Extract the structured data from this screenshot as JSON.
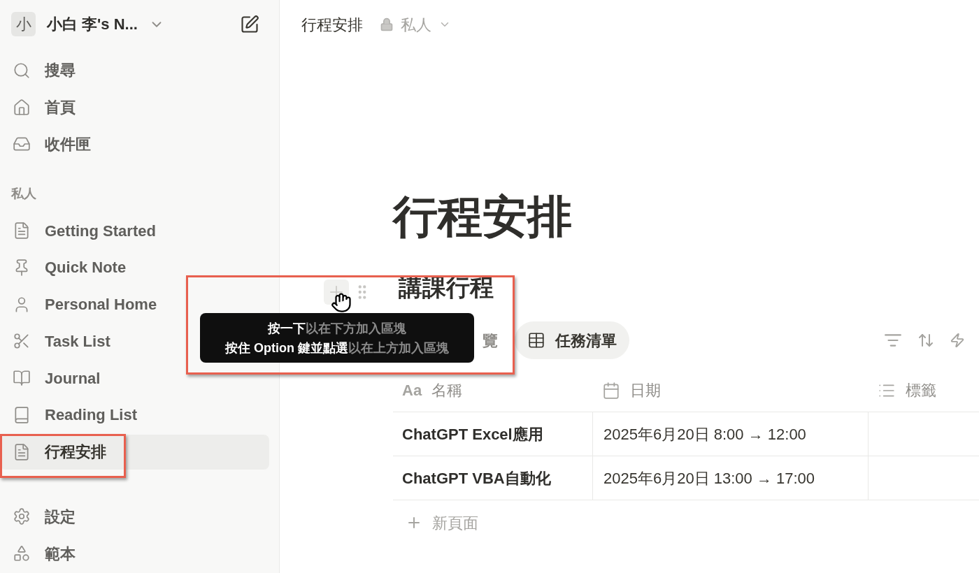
{
  "workspace": {
    "avatar": "小",
    "name": "小白 李's N..."
  },
  "nav": [
    {
      "label": "搜尋",
      "kind": "search"
    },
    {
      "label": "首頁",
      "kind": "home"
    },
    {
      "label": "收件匣",
      "kind": "inbox"
    }
  ],
  "section_label": "私人",
  "pages": [
    {
      "label": "Getting Started",
      "kind": "page",
      "selected": false
    },
    {
      "label": "Quick Note",
      "kind": "pin",
      "selected": false
    },
    {
      "label": "Personal Home",
      "kind": "person",
      "selected": false
    },
    {
      "label": "Task List",
      "kind": "scissors",
      "selected": false
    },
    {
      "label": "Journal",
      "kind": "book-open",
      "selected": false
    },
    {
      "label": "Reading List",
      "kind": "book",
      "selected": false
    },
    {
      "label": "行程安排",
      "kind": "page",
      "selected": true
    }
  ],
  "bottom_nav": [
    {
      "label": "設定",
      "kind": "gear"
    },
    {
      "label": "範本",
      "kind": "shapes"
    }
  ],
  "breadcrumb": {
    "title": "行程安排",
    "privacy": "私人"
  },
  "page_title": "行程安排",
  "database": {
    "title": "講課行程",
    "views": [
      {
        "label": "覽",
        "kind": "plain",
        "selected": false
      },
      {
        "label": "任務清單",
        "kind": "table",
        "selected": true
      }
    ],
    "columns": [
      {
        "label": "名稱",
        "type_mark": "Aa",
        "kind": "text"
      },
      {
        "label": "日期",
        "kind": "calendar"
      },
      {
        "label": "標籤",
        "kind": "list"
      }
    ],
    "rows": [
      {
        "name": "ChatGPT Excel應用",
        "date": "2025年6月20日 8:00 → 12:00"
      },
      {
        "name": "ChatGPT VBA自動化",
        "date": "2025年6月20日 13:00 → 17:00"
      }
    ],
    "new_page": "新頁面"
  },
  "tooltip": [
    "**按一下**以在下方加入區塊",
    "**按住 Option 鍵並點選**以在上方加入區塊"
  ]
}
